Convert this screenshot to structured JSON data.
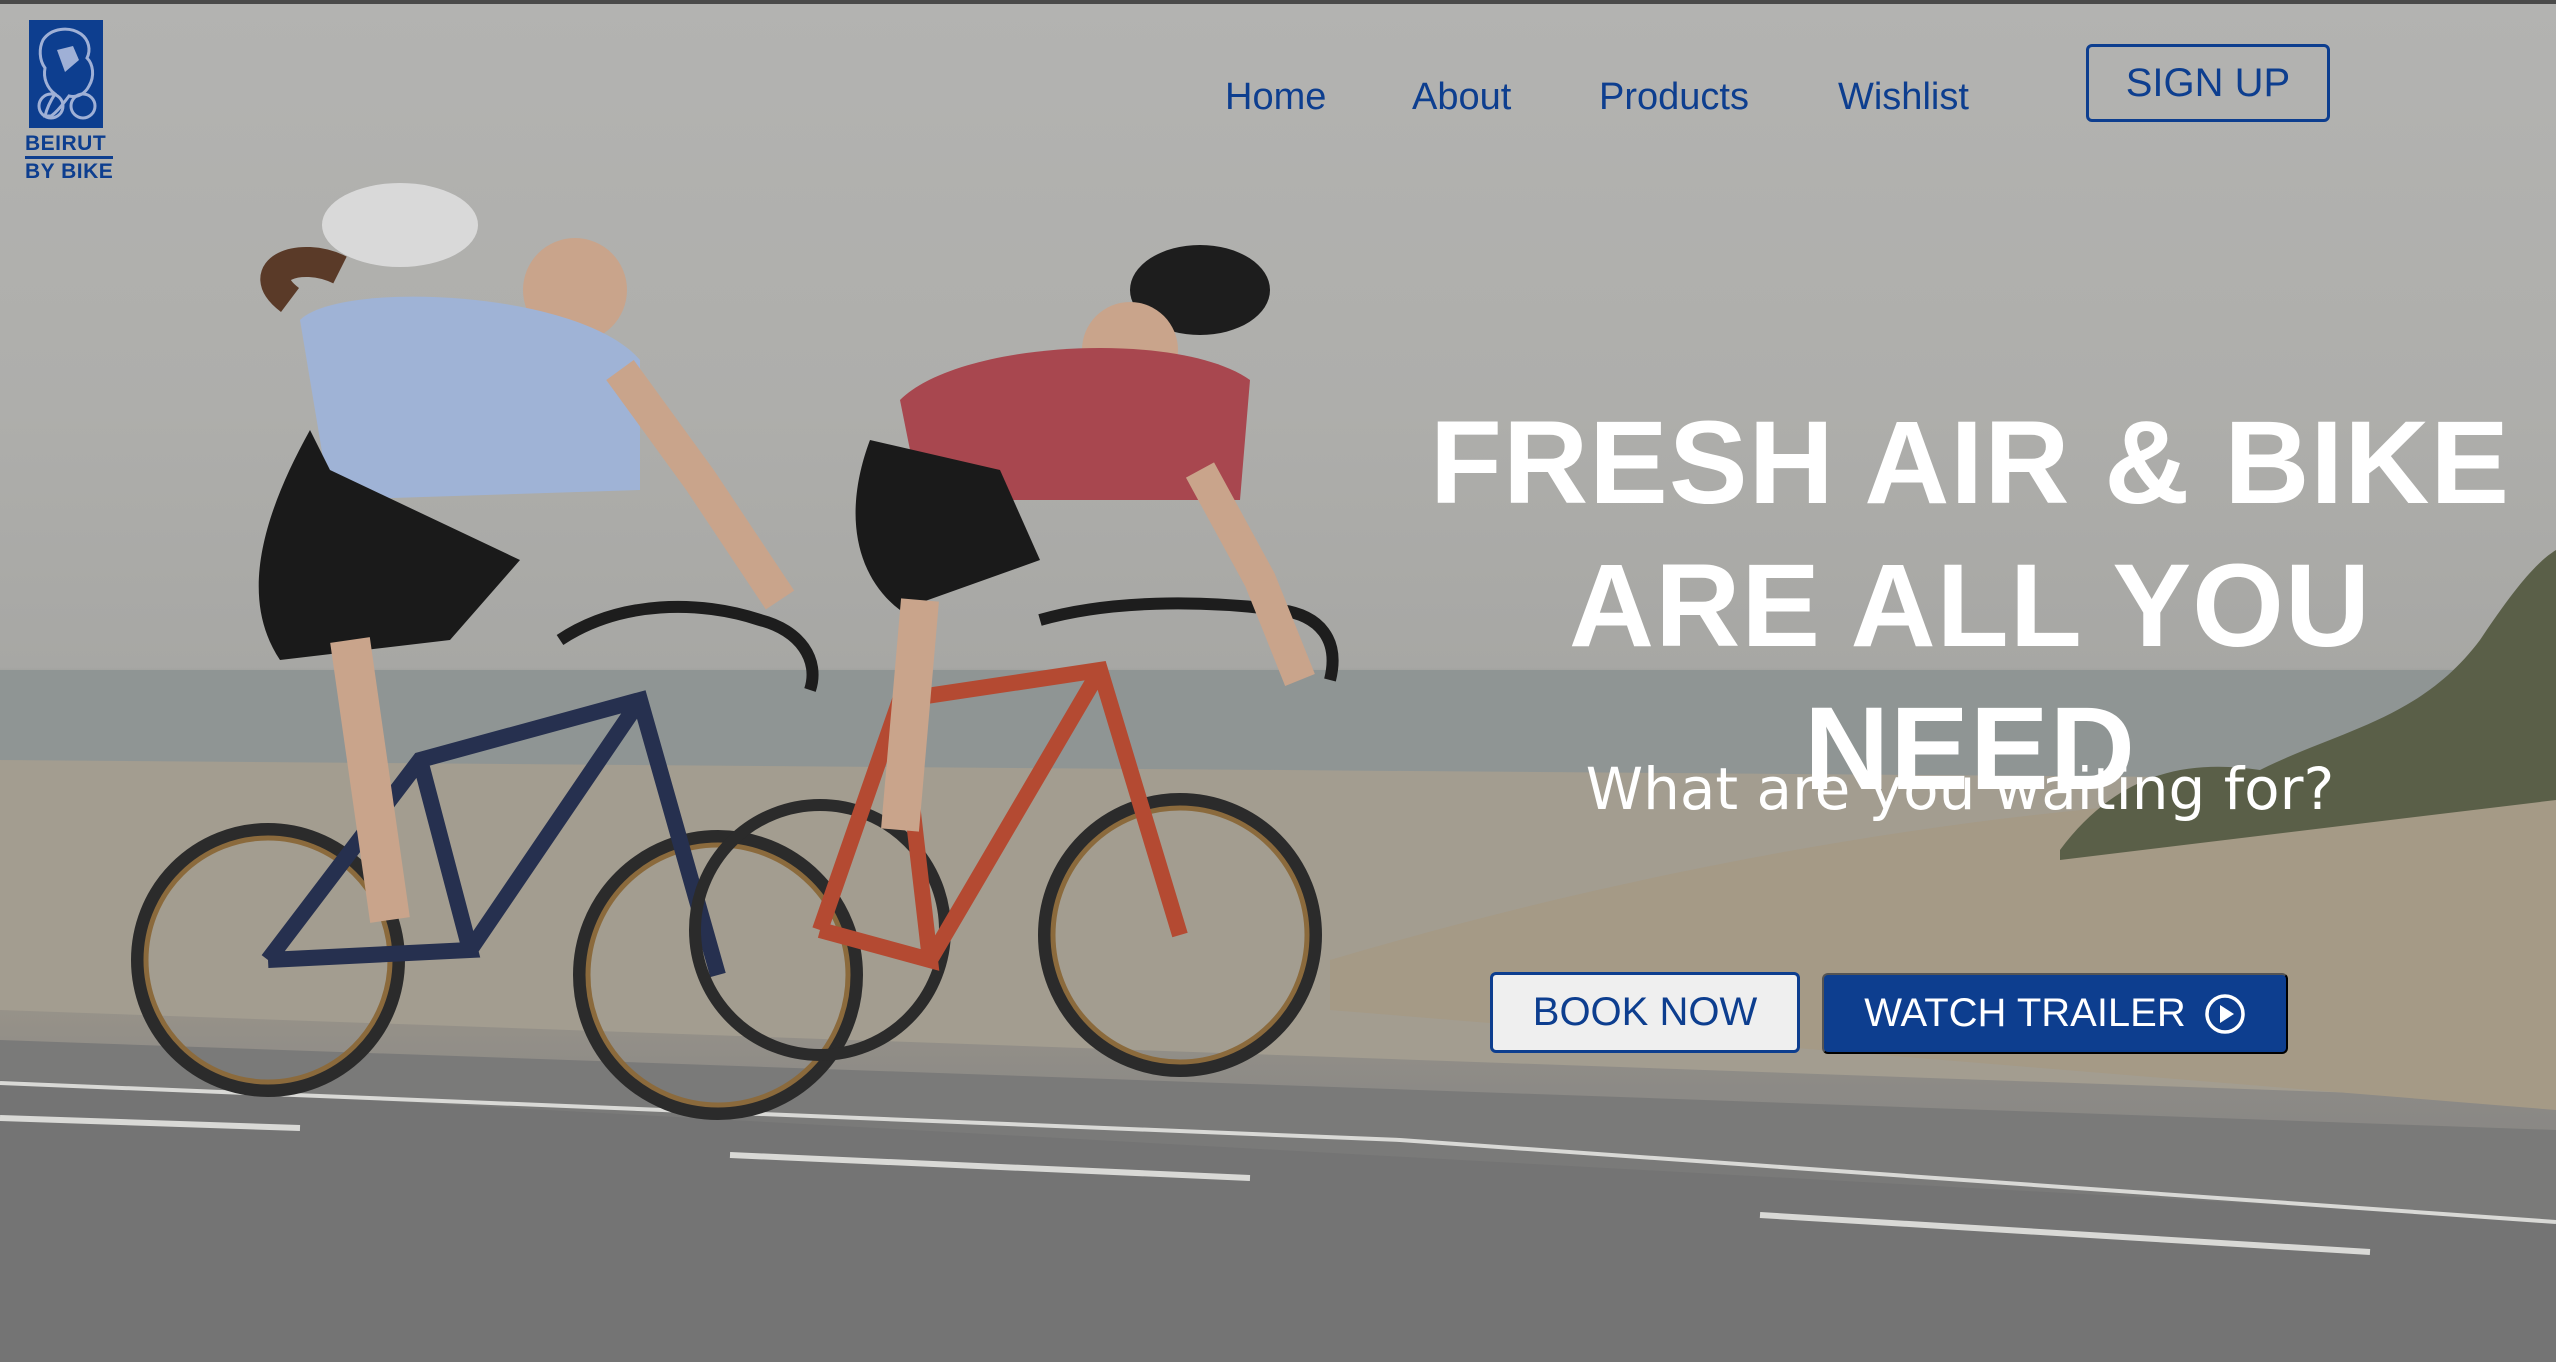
{
  "brand": {
    "name_line1": "BEIRUT",
    "name_line2": "BY BIKE",
    "logo_icon": "cyclist-emblem-icon",
    "color": "#0d3e8f"
  },
  "nav": {
    "items": [
      {
        "label": "Home"
      },
      {
        "label": "About"
      },
      {
        "label": "Products"
      },
      {
        "label": "Wishlist"
      }
    ],
    "signup_label": "SIGN UP"
  },
  "hero": {
    "headline_line1": "FRESH AIR & BIKE",
    "headline_line2": "ARE ALL YOU NEED",
    "subheadline": "What are you waiting for?",
    "book_label": "BOOK NOW",
    "trailer_label": "WATCH TRAILER",
    "trailer_icon": "play-circle-icon",
    "background_image": "two-cyclists-road-beach-photo"
  },
  "colors": {
    "accent": "#0d3e8f",
    "headline": "#ffffff"
  }
}
